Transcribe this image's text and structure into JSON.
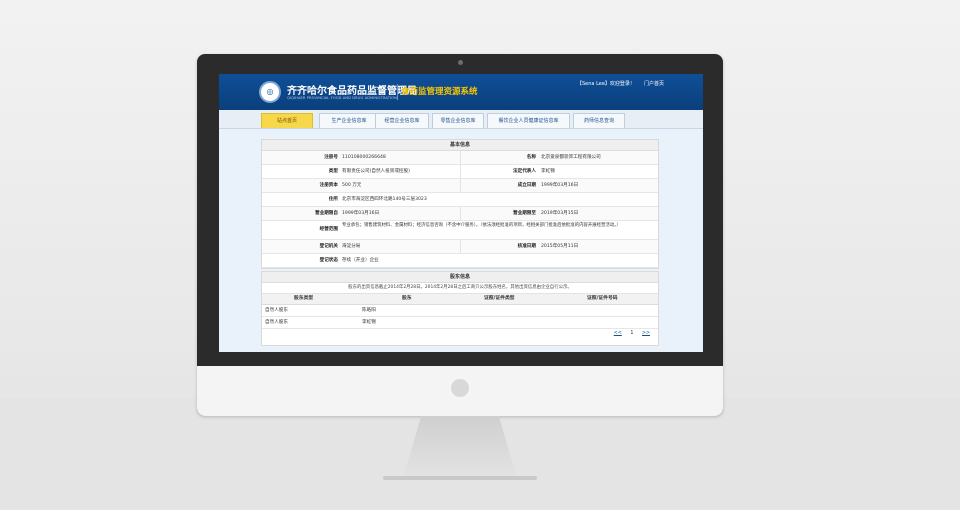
{
  "header": {
    "org_name_cn": "齐齐哈尔食品药品监督管理局",
    "org_name_en": "QIQIHAER PROVINCIAL FOOD AND DRUG ADMINISTRATION",
    "system_name": "食药监管理资源系统",
    "user_welcome": "【Sena Lee】欢迎登录！",
    "portal_link": "门户首页",
    "seal_glyph": "◎"
  },
  "nav": {
    "tabs": [
      "站点首页",
      "生产企业信息库",
      "经营企业信息库",
      "零售企业信息库",
      "餐饮企业人员健康证信息库",
      "药师信息查询"
    ],
    "active_index": 0
  },
  "basic_info": {
    "title": "基本信息",
    "reg_no_label": "注册号",
    "reg_no_value": "110108000266648",
    "name_label": "名称",
    "name_value": "北京爱泉都装饰工程有限公司",
    "type_label": "类型",
    "type_value": "有限责任公司(自然人投资或控股)",
    "legal_rep_label": "法定代表人",
    "legal_rep_value": "李虹锦",
    "capital_label": "注册资本",
    "capital_value": "500 万元",
    "est_date_label": "成立日期",
    "est_date_value": "1999年03月16日",
    "address_label": "住所",
    "address_value": "北京市海淀区西四环北路140号三层3023",
    "term_from_label": "营业期限自",
    "term_from_value": "1999年03月16日",
    "term_to_label": "营业期限至",
    "term_to_value": "2019年03月15日",
    "scope_label": "经营范围",
    "scope_value": "专业承包；销售建筑材料、金属材料；经济信息咨询（不含中介服务）。（依法须经批准的项目，经相关部门批准后依批准的内容开展经营活动。）",
    "authority_label": "登记机关",
    "authority_value": "海淀分局",
    "approval_label": "核准日期",
    "approval_value": "2015年05月11日",
    "status_label": "登记状态",
    "status_value": "存续（开业）企业"
  },
  "shareholders": {
    "title": "股东信息",
    "note": "股东的出资信息截止2014年2月28日。2014年2月28日之后工商只公示股东姓名，其他出资信息由企业自行公示。",
    "columns": [
      "股东类型",
      "股东",
      "证照/证件类型",
      "证照/证件号码"
    ],
    "rows": [
      {
        "type": "自然人股东",
        "name": "陈皓阳",
        "doc_type": "",
        "doc_no": ""
      },
      {
        "type": "自然人股东",
        "name": "李虹锦",
        "doc_type": "",
        "doc_no": ""
      }
    ],
    "pager": {
      "prev": "<<",
      "current": "1",
      "next": ">>"
    }
  }
}
